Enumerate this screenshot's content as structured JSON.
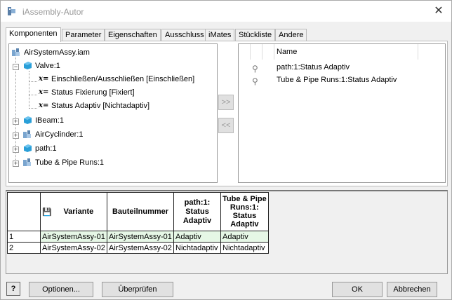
{
  "window": {
    "title": "iAssembly-Autor"
  },
  "tabs": [
    {
      "label": "Komponenten"
    },
    {
      "label": "Parameter"
    },
    {
      "label": "Eigenschaften"
    },
    {
      "label": "Ausschluss"
    },
    {
      "label": "iMates"
    },
    {
      "label": "Stückliste"
    },
    {
      "label": "Andere"
    }
  ],
  "tree": {
    "root": "AirSystemAssy.iam",
    "items": [
      {
        "label": "Valve:1"
      },
      {
        "label": "Einschließen/Ausschließen [Einschließen]"
      },
      {
        "label": "Status Fixierung [Fixiert]"
      },
      {
        "label": "Status Adaptiv [Nichtadaptiv]"
      },
      {
        "label": "IBeam:1"
      },
      {
        "label": "AirCyclinder:1"
      },
      {
        "label": "path:1"
      },
      {
        "label": "Tube & Pipe Runs:1"
      }
    ],
    "param_prefix": "x="
  },
  "mid_buttons": {
    "add": ">>",
    "remove": "<<"
  },
  "rightlist": {
    "header_name": "Name",
    "rows": [
      {
        "label": "path:1:Status Adaptiv"
      },
      {
        "label": "Tube & Pipe Runs:1:Status Adaptiv"
      }
    ]
  },
  "grid": {
    "headers": {
      "variante": "Variante",
      "bauteilnummer": "Bauteilnummer",
      "path_status_1": "path:1:",
      "path_status_2": "Status",
      "path_status_3": "Adaptiv",
      "tube_status_1": "Tube & Pipe",
      "tube_status_2": "Runs:1:",
      "tube_status_3": "Status",
      "tube_status_4": "Adaptiv"
    },
    "rows": [
      {
        "num": "1",
        "variante": "AirSystemAssy-01",
        "bauteilnummer": "AirSystemAssy-01",
        "path": "Adaptiv",
        "tube": "Adaptiv"
      },
      {
        "num": "2",
        "variante": "AirSystemAssy-02",
        "bauteilnummer": "AirSystemAssy-02",
        "path": "Nichtadaptiv",
        "tube": "Nichtadaptiv"
      }
    ]
  },
  "buttons": {
    "help": "?",
    "optionen": "Optionen...",
    "ueberpruefen": "Überprüfen",
    "ok": "OK",
    "abbrechen": "Abbrechen"
  },
  "colors": {
    "cube": "#2a9fd8",
    "selected_cell": "#e6f7e6"
  }
}
